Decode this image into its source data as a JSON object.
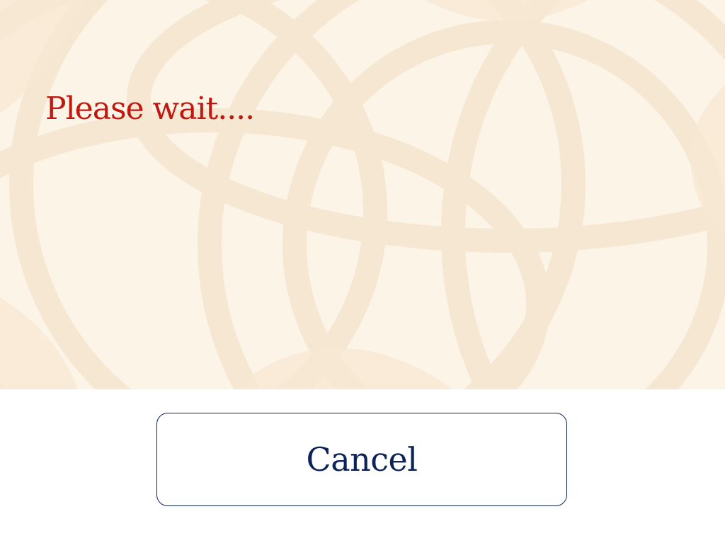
{
  "status": {
    "message": "Please wait...."
  },
  "actions": {
    "cancel_label": "Cancel"
  },
  "theme": {
    "background": "#fcf4e6",
    "pattern": "#f6e7d1",
    "message_color": "#c0180f",
    "button_color": "#0c2357"
  },
  "icons": {
    "background_pattern": "rosette-pattern"
  }
}
